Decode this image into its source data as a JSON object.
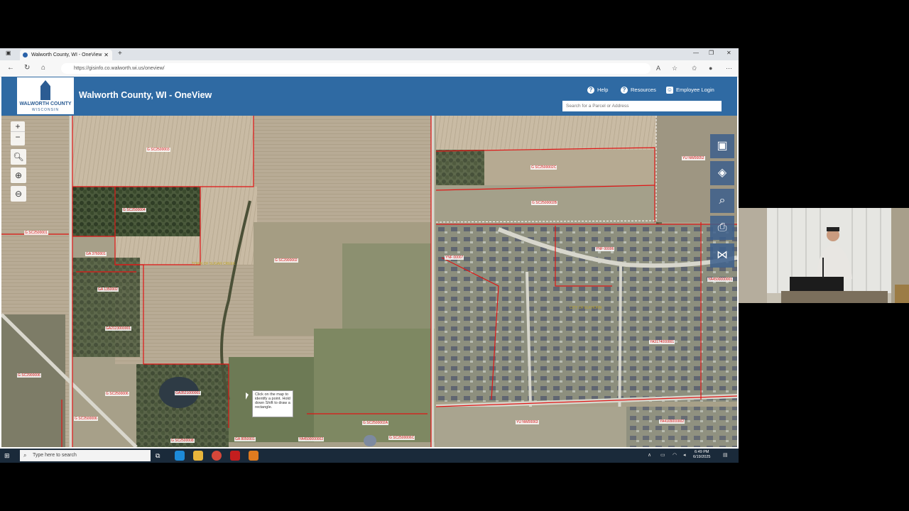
{
  "browser": {
    "tab_title": "Walworth County, WI - OneView",
    "url": "https://gisinfo.co.walworth.wi.us/oneview/"
  },
  "header": {
    "logo_line1": "WALWORTH COUNTY",
    "logo_line2": "WISCONSIN",
    "title": "Walworth County, WI - OneView",
    "help": "Help",
    "resources": "Resources",
    "employee_login": "Employee Login",
    "search_placeholder": "Search for a Parcel or Address"
  },
  "map": {
    "tooltip": "Click on the map to identify a point. Hold down Shift to draw a rectangle.",
    "labels": {
      "l1": "G SC2500003",
      "l2": "G SC2500004",
      "l3": "G SC2500001",
      "l4": "GA 3760001",
      "l5": "G SC2900002",
      "l6": "GA 1350002",
      "l7": "GA2123000001",
      "l8": "G SC2900006",
      "l9": "G SC2500006",
      "l10": "GA3521000001",
      "l11": "G SC2500006",
      "l12": "G SC2500002A",
      "l13": "G SC2500002C",
      "l14": "G SC2500002B",
      "l15": "YU NW00052",
      "l16": "YNF 00007",
      "l17": "YNF 00006",
      "l18": "YU NW00063",
      "l19": "YA3174000001",
      "l20": "YA4500000001",
      "l21": "YA4165000002",
      "l22": "G SC2500006C",
      "l23": "YA4500000002",
      "l24": "G SC2500008",
      "l25": "GA 8050001"
    },
    "gold_labels": {
      "g1": "TOWN OF SUGAR CREEK",
      "g2": "CITY OF ELKHORN"
    }
  },
  "taskbar": {
    "search": "Type here to search",
    "time": "6:49 PM",
    "date": "6/19/2025"
  }
}
